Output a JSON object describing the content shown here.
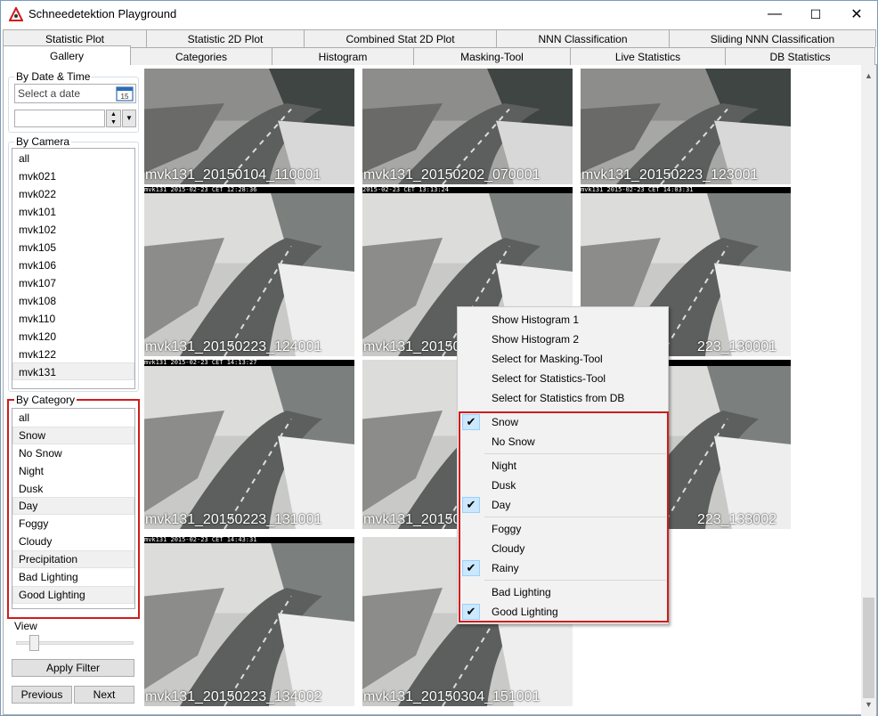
{
  "window": {
    "title": "Schneedetektion Playground",
    "minimize": "—",
    "maximize": "☐",
    "close": "✕"
  },
  "tabs_row1": [
    {
      "label": "Statistic Plot"
    },
    {
      "label": "Statistic 2D Plot"
    },
    {
      "label": "Combined Stat 2D Plot"
    },
    {
      "label": "NNN Classification"
    },
    {
      "label": "Sliding NNN Classification"
    }
  ],
  "tabs_row2": [
    {
      "label": "Gallery"
    },
    {
      "label": "Categories"
    },
    {
      "label": "Histogram"
    },
    {
      "label": "Masking-Tool"
    },
    {
      "label": "Live Statistics"
    },
    {
      "label": "DB Statistics"
    }
  ],
  "filters": {
    "date_group": "By Date & Time",
    "date_placeholder": "Select a date",
    "calendar_day": "15",
    "camera_group": "By Camera",
    "cameras": [
      "all",
      "mvk021",
      "mvk022",
      "mvk101",
      "mvk102",
      "mvk105",
      "mvk106",
      "mvk107",
      "mvk108",
      "mvk110",
      "mvk120",
      "mvk122",
      "mvk131"
    ],
    "selected_camera": "mvk131",
    "category_group": "By Category",
    "categories": [
      "all",
      "Snow",
      "No Snow",
      "Night",
      "Dusk",
      "Day",
      "Foggy",
      "Cloudy",
      "Precipitation",
      "Bad Lighting",
      "Good Lighting"
    ],
    "selected_categories": [
      "Snow",
      "Day",
      "Precipitation",
      "Good Lighting"
    ],
    "view_group": "View",
    "view_level": 0.2,
    "apply_label": "Apply Filter",
    "prev_label": "Previous",
    "next_label": "Next"
  },
  "gallery": [
    {
      "caption": "mvk131_20150104_110001",
      "stamp": ""
    },
    {
      "caption": "mvk131_20150202_070001",
      "stamp": ""
    },
    {
      "caption": "mvk131_20150223_123001",
      "stamp": ""
    },
    {
      "caption": "mvk131_20150223_124001",
      "stamp": "mvk131                    2015-02-23 CET 12:28:36"
    },
    {
      "caption": "mvk131_20150",
      "stamp": "                          2015-02-23 CET 13:13:24"
    },
    {
      "caption": "223_130001",
      "stamp": "mvk131                    2015-02-23 CET 14:03:31"
    },
    {
      "caption": "mvk131_20150223_131001",
      "stamp": "mvk131                    2015-02-23 CET 14:13:27"
    },
    {
      "caption": "mvk131_20150",
      "stamp": ""
    },
    {
      "caption": "223_133002",
      "stamp": "                          2015-02-23 CET 14:33:31"
    },
    {
      "caption": "mvk131_20150223_134002",
      "stamp": "mvk131                    2015-02-23 CET 14:43:31"
    },
    {
      "caption": "mvk131_20150304_151001",
      "stamp": ""
    }
  ],
  "context_menu": {
    "actions": [
      "Show Histogram 1",
      "Show Histogram 2",
      "Select for Masking-Tool",
      "Select for Statistics-Tool",
      "Select for Statistics from DB"
    ],
    "snow": [
      {
        "label": "Snow",
        "checked": true
      },
      {
        "label": "No Snow",
        "checked": false
      }
    ],
    "time": [
      {
        "label": "Night",
        "checked": false
      },
      {
        "label": "Dusk",
        "checked": false
      },
      {
        "label": "Day",
        "checked": true
      }
    ],
    "weather": [
      {
        "label": "Foggy",
        "checked": false
      },
      {
        "label": "Cloudy",
        "checked": false
      },
      {
        "label": "Rainy",
        "checked": true
      }
    ],
    "lighting": [
      {
        "label": "Bad Lighting",
        "checked": false
      },
      {
        "label": "Good Lighting",
        "checked": true
      }
    ],
    "check_glyph": "✔"
  },
  "colors": {
    "highlight_red": "#d01c1c",
    "check_bg": "#cce8ff"
  }
}
